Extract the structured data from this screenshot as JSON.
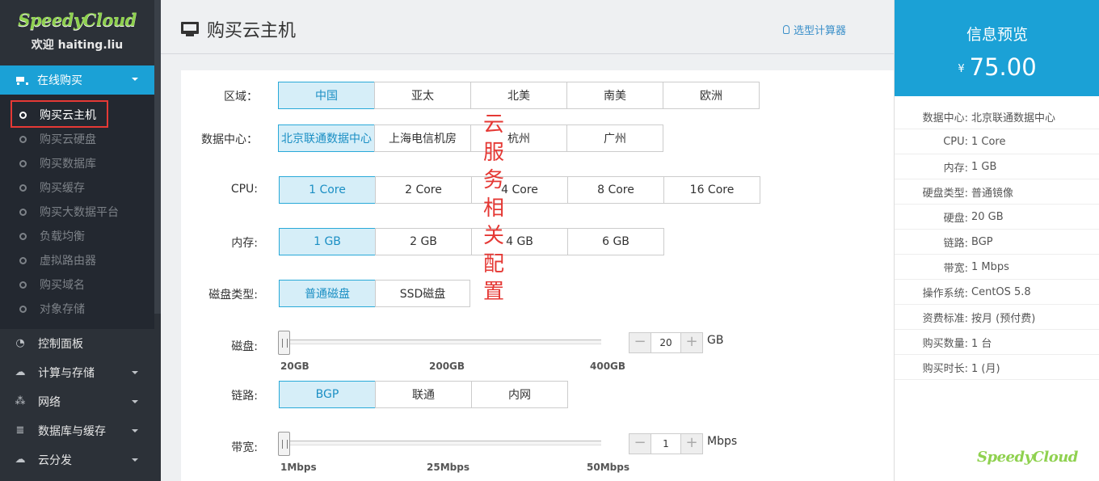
{
  "app": {
    "brand": "SpeedyCloud",
    "welcome": "欢迎 haiting.liu"
  },
  "sidebar": {
    "active_menu": "在线购买",
    "sub_items": [
      "购买云主机",
      "购买云硬盘",
      "购买数据库",
      "购买缓存",
      "购买大数据平台",
      "负载均衡",
      "虚拟路由器",
      "购买域名",
      "对象存储"
    ],
    "current_sub": "购买云主机",
    "nav_items": [
      {
        "label": "控制面板",
        "icon": "dashboard-icon",
        "has_caret": false
      },
      {
        "label": "计算与存储",
        "icon": "cloud-icon",
        "has_caret": true
      },
      {
        "label": "网络",
        "icon": "sitemap-icon",
        "has_caret": true
      },
      {
        "label": "数据库与缓存",
        "icon": "database-icon",
        "has_caret": true
      },
      {
        "label": "云分发",
        "icon": "cloud-upload-icon",
        "has_caret": true
      }
    ]
  },
  "header": {
    "title": "购买云主机",
    "calc_link": "选型计算器"
  },
  "form": {
    "region": {
      "label": "区域：",
      "options": [
        "中国",
        "亚太",
        "北美",
        "南美",
        "欧洲"
      ],
      "selected": "中国"
    },
    "datacenter": {
      "label": "数据中心：",
      "options": [
        "北京联通数据中心",
        "上海电信机房",
        "杭州",
        "广州"
      ],
      "selected": "北京联通数据中心"
    },
    "cpu": {
      "label": "CPU:",
      "options": [
        "1 Core",
        "2 Core",
        "4 Core",
        "8 Core",
        "16 Core"
      ],
      "selected": "1 Core"
    },
    "memory": {
      "label": "内存:",
      "options": [
        "1 GB",
        "2 GB",
        "4 GB",
        "6 GB"
      ],
      "selected": "1 GB"
    },
    "disk_type": {
      "label": "磁盘类型:",
      "options": [
        "普通磁盘",
        "SSD磁盘"
      ],
      "selected": "普通磁盘"
    },
    "disk": {
      "label": "磁盘:",
      "ticks": [
        "20GB",
        "200GB",
        "400GB"
      ],
      "min": 20,
      "max": 400,
      "value": "20",
      "unit": "GB",
      "minus": "−",
      "plus": "+"
    },
    "link": {
      "label": "链路:",
      "options": [
        "BGP",
        "联通",
        "内网"
      ],
      "selected": "BGP"
    },
    "bandwidth": {
      "label": "带宽:",
      "ticks": [
        "1Mbps",
        "25Mbps",
        "50Mbps"
      ],
      "min": 1,
      "max": 50,
      "value": "1",
      "unit": "Mbps",
      "minus": "−",
      "plus": "+"
    }
  },
  "annotation": "云服务相关配置",
  "panel": {
    "title": "信息预览",
    "currency": "¥",
    "price": "75.00",
    "rows": [
      {
        "k": "数据中心:",
        "v": "北京联通数据中心"
      },
      {
        "k": "CPU:",
        "v": "1 Core"
      },
      {
        "k": "内存:",
        "v": "1 GB"
      },
      {
        "k": "硬盘类型:",
        "v": "普通镜像"
      },
      {
        "k": "硬盘:",
        "v": "20 GB"
      },
      {
        "k": "链路:",
        "v": "BGP"
      },
      {
        "k": "带宽:",
        "v": "1 Mbps"
      },
      {
        "k": "操作系统:",
        "v": "CentOS 5.8"
      },
      {
        "k": "资费标准:",
        "v": "按月 (预付费)"
      },
      {
        "k": "购买数量:",
        "v": "1 台"
      },
      {
        "k": "购买时长:",
        "v": "1 (月)"
      }
    ],
    "logo": "SpeedyCloud"
  },
  "colors": {
    "accent": "#1ba1d6",
    "sidebar_bg": "#2c3138",
    "selected_bg": "#d6eef8",
    "annotation": "#e53935",
    "brand_green": "#8fd14f"
  }
}
